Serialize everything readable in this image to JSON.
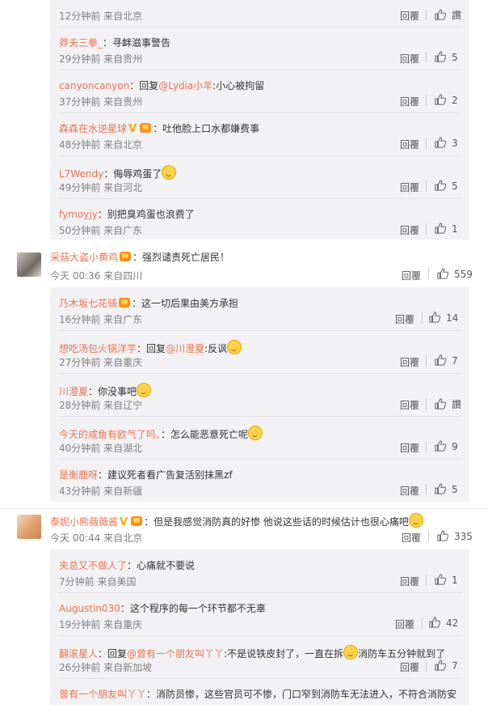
{
  "reply_label": "回覆",
  "first_replies": [
    {
      "name": "",
      "text": "",
      "time": "12分钟前",
      "source": "来自北京",
      "likes": "讚",
      "partial": true
    },
    {
      "name": "莽夫三拳_",
      "text": "：寻衅滋事警告",
      "time": "29分钟前",
      "source": "来自贵州",
      "likes": "5"
    },
    {
      "name": "canyoncanyon",
      "text_pre": "：回复",
      "at": "@Lydia小羊",
      "text": ":小心被拘留",
      "time": "37分钟前",
      "source": "来自贵州",
      "likes": "2"
    },
    {
      "name": "森森在水逆星球",
      "badges": [
        "v",
        "crown"
      ],
      "text": "：吐他脸上口水都嫌费事",
      "time": "48分钟前",
      "source": "来自北京",
      "likes": "3"
    },
    {
      "name": "L7Wendy",
      "text": "：侮辱鸡蛋了",
      "emoji": "dog-emoji",
      "time": "49分钟前",
      "source": "来自河北",
      "likes": "5"
    },
    {
      "name": "fymoyjy",
      "text": "：别把臭鸡蛋也浪费了",
      "time": "50分钟前",
      "source": "来自广东",
      "likes": "1"
    }
  ],
  "comment2": {
    "name": "采菇大盗小黄鸡",
    "badges": [
      "crown"
    ],
    "text": "：强烈谴责死亡居民！",
    "time": "今天 00:36",
    "source": "来自四川",
    "likes": "559",
    "replies": [
      {
        "name": "乃木坂七花骑",
        "badges": [
          "crown"
        ],
        "text": "：这一切后果由美方承担",
        "time": "16分钟前",
        "source": "来自广东",
        "likes": "14"
      },
      {
        "name": "想吃汤包火锅洋芋",
        "text_pre": "：回复",
        "at": "@川澄夏",
        "text": ":反讽",
        "emoji": "dog-emoji",
        "time": "27分钟前",
        "source": "来自重庆",
        "likes": "7"
      },
      {
        "name": "川澄夏",
        "text": "：你没事吧",
        "emoji": "smile-emoji",
        "time": "28分钟前",
        "source": "来自辽宁",
        "likes": "讚"
      },
      {
        "name": "今天的咸鱼有欧气了吗、",
        "text": "：怎么能恶意死亡呢",
        "emoji": "shy-emoji",
        "time": "40分钟前",
        "source": "来自湖北",
        "likes": "9"
      },
      {
        "name": "是衡鹿呀",
        "text": "：建议死者看广告复活别抹黑zf",
        "time": "43分钟前",
        "source": "来自新疆",
        "likes": "5"
      }
    ]
  },
  "comment3": {
    "name": "泰妮小熊薇薇酱",
    "badges": [
      "v",
      "crown"
    ],
    "text": "：但是我感觉消防真的好惨 他说这些话的时候估计也很心痛吧",
    "emoji": "cry-emoji",
    "time": "今天 00:44",
    "source": "来自北京",
    "likes": "335",
    "replies": [
      {
        "name": "夹总又不做人了",
        "text": "：心痛就不要说",
        "time": "7分钟前",
        "source": "来自美国",
        "likes": "1"
      },
      {
        "name": "Augustin030",
        "text": "：这个程序的每一个环节都不无辜",
        "time": "19分钟前",
        "source": "来自重庆",
        "likes": "42"
      },
      {
        "name": "翻滚星人",
        "text_pre": "：回复",
        "at": "@曾有一个朋友叫丫丫",
        "text": ":不是说铁皮封了，一直在拆",
        "emoji": "smile-emoji",
        "text_post": "消防车五分钟就到了",
        "time": "26分钟前",
        "source": "来自新加坡",
        "likes": "7"
      },
      {
        "name": "曾有一个朋友叫丫丫",
        "text": "：消防员惨，这些官员可不惨，门口窄到消防车无法进入，不符合消防安",
        "partial": true
      }
    ]
  },
  "colors": {
    "name": "#eb7350",
    "reply_bg": "#f2f2f5",
    "meta": "#808080"
  }
}
